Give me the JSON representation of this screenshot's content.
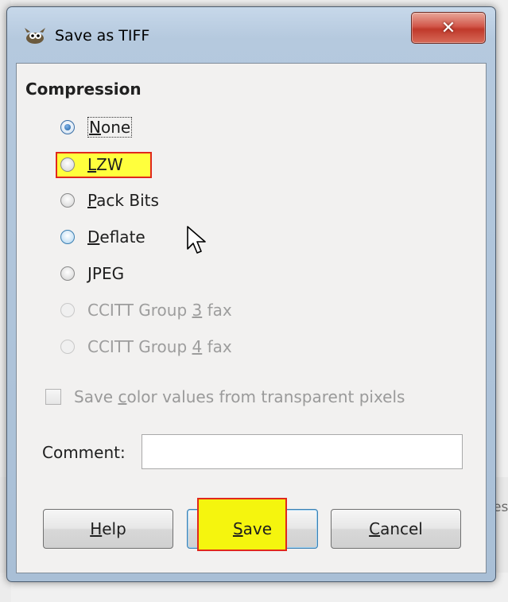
{
  "window": {
    "title": "Save as TIFF",
    "close_glyph": "✕"
  },
  "compression": {
    "title": "Compression",
    "options": [
      {
        "pre": "",
        "u": "N",
        "post": "one",
        "checked": true,
        "enabled": true
      },
      {
        "pre": "",
        "u": "L",
        "post": "ZW",
        "checked": false,
        "enabled": true
      },
      {
        "pre": "",
        "u": "P",
        "post": "ack Bits",
        "checked": false,
        "enabled": true
      },
      {
        "pre": "",
        "u": "D",
        "post": "eflate",
        "checked": false,
        "enabled": true
      },
      {
        "pre": "",
        "u": "J",
        "post": "PEG",
        "checked": false,
        "enabled": true
      },
      {
        "pre": "CCITT Group ",
        "u": "3",
        "post": " fax",
        "checked": false,
        "enabled": false
      },
      {
        "pre": "CCITT Group ",
        "u": "4",
        "post": " fax",
        "checked": false,
        "enabled": false
      }
    ]
  },
  "transparent": {
    "pre": "Save ",
    "u": "c",
    "post": "olor values from transparent pixels",
    "checked": false,
    "enabled": false
  },
  "comment": {
    "label": "Comment:",
    "value": ""
  },
  "buttons": {
    "help": {
      "u": "H",
      "post": "elp"
    },
    "save": {
      "u": "S",
      "post": "ave"
    },
    "cancel": {
      "u": "C",
      "post": "ancel"
    }
  },
  "background": {
    "edge_text": "es"
  },
  "icons": {
    "app": "gimp-wilber-icon",
    "close": "close-icon",
    "cursor": "mouse-pointer-icon"
  },
  "colors": {
    "highlight_fill": "#ffff3d",
    "highlight_border": "#e0281c",
    "close_button": "#c0392b"
  }
}
